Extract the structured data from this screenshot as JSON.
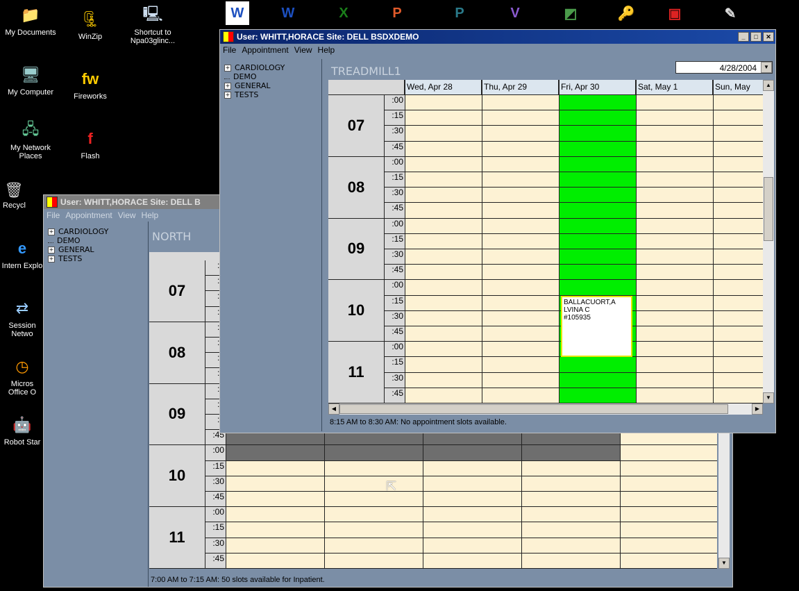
{
  "desktop": {
    "left_icons": [
      {
        "label": "My Documents",
        "icon": "folder-icon"
      },
      {
        "label": "My Computer",
        "icon": "computer-icon"
      },
      {
        "label": "My Network Places",
        "icon": "network-icon"
      },
      {
        "label": "Recycl",
        "icon": "recycle-bin-icon"
      },
      {
        "label": "Intern Explo",
        "icon": "internet-explorer-icon"
      },
      {
        "label": "Session Netwo",
        "icon": "session-icon"
      },
      {
        "label": "Micros Office O",
        "icon": "office-icon"
      },
      {
        "label": "Robot Star",
        "icon": "robot-icon"
      }
    ],
    "col2_icons": [
      {
        "label": "WinZip",
        "icon": "winzip-icon"
      },
      {
        "label": "Fireworks",
        "icon": "fireworks-icon"
      },
      {
        "label": "Flash",
        "icon": "flash-icon"
      }
    ],
    "col3_icons": [
      {
        "label": "Shortcut to Npa03glinc...",
        "icon": "shortcut-icon"
      }
    ]
  },
  "back_window": {
    "title": "User: WHITT,HORACE Site: DELL B",
    "menu": [
      "File",
      "Appointment",
      "View",
      "Help"
    ],
    "tree": [
      {
        "label": "CARDIOLOGY",
        "expandable": true
      },
      {
        "label": "DEMO",
        "expandable": false
      },
      {
        "label": "GENERAL",
        "expandable": true
      },
      {
        "label": "TESTS",
        "expandable": true
      }
    ],
    "resource": "NORTH",
    "hours": [
      {
        "hour": "07",
        "mins": [
          ":0",
          ":1",
          ":3",
          ":4"
        ]
      },
      {
        "hour": "08",
        "mins": [
          ":0",
          ":1",
          ":3",
          ":4"
        ]
      },
      {
        "hour": "09",
        "mins": [
          ":0",
          ":1",
          ":3",
          ":45"
        ]
      },
      {
        "hour": "10",
        "mins": [
          ":00",
          ":15",
          ":30",
          ":45"
        ]
      },
      {
        "hour": "11",
        "mins": [
          ":00",
          ":15",
          ":30",
          ":45"
        ]
      }
    ],
    "status": "7:00 AM to 7:15 AM: 50 slots available for Inpatient."
  },
  "front_window": {
    "title": "User: WHITT,HORACE Site: DELL BSDXDEMO",
    "menu": [
      "File",
      "Appointment",
      "View",
      "Help"
    ],
    "tree": [
      {
        "label": "CARDIOLOGY",
        "expandable": true
      },
      {
        "label": "DEMO",
        "expandable": false
      },
      {
        "label": "GENERAL",
        "expandable": true
      },
      {
        "label": "TESTS",
        "expandable": true
      }
    ],
    "resource": "TREADMILL1",
    "date": "4/28/2004",
    "days": [
      "Wed, Apr 28",
      "Thu, Apr 29",
      "Fri, Apr 30",
      "Sat, May 1",
      "Sun, May"
    ],
    "hours": [
      {
        "hour": "07",
        "mins": [
          ":00",
          ":15",
          ":30",
          ":45"
        ]
      },
      {
        "hour": "08",
        "mins": [
          ":00",
          ":15",
          ":30",
          ":45"
        ]
      },
      {
        "hour": "09",
        "mins": [
          ":00",
          ":15",
          ":30",
          ":45"
        ]
      },
      {
        "hour": "10",
        "mins": [
          ":00",
          ":15",
          ":30",
          ":45"
        ]
      },
      {
        "hour": "11",
        "mins": [
          ":00",
          ":15",
          ":30",
          ":45"
        ]
      }
    ],
    "appointment": {
      "name": "BALLACUORT,A LVINA C",
      "id": "#105935"
    },
    "status": "8:15 AM to 8:30 AM: No appointment slots available.",
    "colors": {
      "available": "#fdf2d4",
      "highlight": "#00ee00",
      "blocked": "#6e6e6e",
      "titlebar": "#0a246a"
    }
  },
  "top_icons": [
    "word-icon",
    "word-icon",
    "excel-icon",
    "powerpoint-icon",
    "publisher-icon",
    "visio-icon",
    "project-icon",
    "access-icon",
    "pdf-icon",
    "pen-icon"
  ]
}
